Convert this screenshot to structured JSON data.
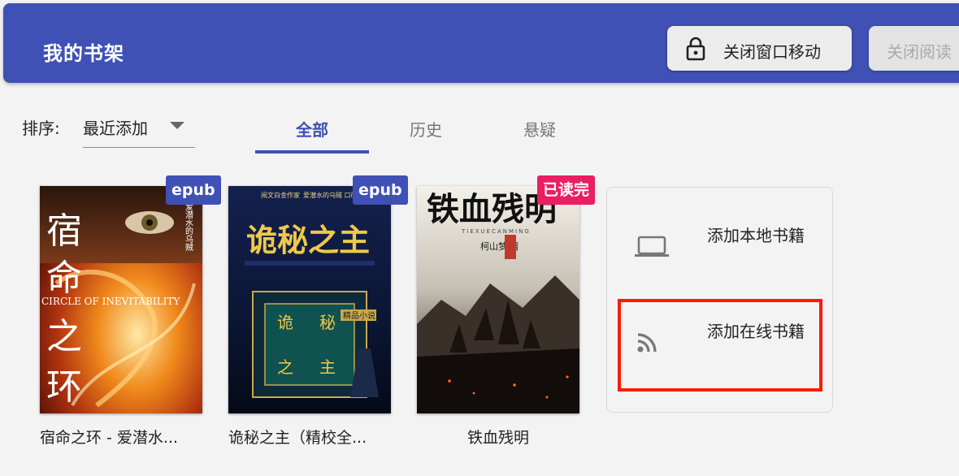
{
  "header": {
    "title": "我的书架",
    "lock_button_label": "关闭窗口移动",
    "reader_button_label": "关闭阅读"
  },
  "sort": {
    "label": "排序:",
    "value": "最近添加"
  },
  "tabs": [
    {
      "label": "全部",
      "active": true
    },
    {
      "label": "历史",
      "active": false
    },
    {
      "label": "悬疑",
      "active": false
    }
  ],
  "books": [
    {
      "badge": "epub",
      "badge_color": "#3f51b5",
      "title": "宿命之环 - 爱潜水...",
      "cover_title": "宿命之环",
      "cover_subtitle": "CIRCLE OF INEVITABILITY",
      "cover_author": "爱潜水的乌贼"
    },
    {
      "badge": "epub",
      "badge_color": "#3f51b5",
      "title": "诡秘之主（精校全...",
      "cover_title": "诡秘之主",
      "cover_top_text": "爱潜水的乌贼 口碑力作",
      "cover_publisher": "阅文白金作家",
      "cover_subtitle": "",
      "cover_tag": "精品小说"
    },
    {
      "badge": "已读完",
      "badge_color": "#e91e63",
      "title": "铁血残明",
      "cover_title": "铁血残明",
      "cover_pinyin": "TIEXUECANMING",
      "cover_author": "柯山梦 著"
    }
  ],
  "add_panel": {
    "local_label": "添加本地书籍",
    "online_label": "添加在线书籍"
  },
  "colors": {
    "primary": "#3f51b5",
    "accent_red": "#e91e63",
    "highlight": "#ff1a00"
  },
  "icons": {
    "lock": "lock-icon",
    "laptop": "laptop-icon",
    "rss": "rss-icon",
    "dropdown": "chevron-down-icon"
  }
}
